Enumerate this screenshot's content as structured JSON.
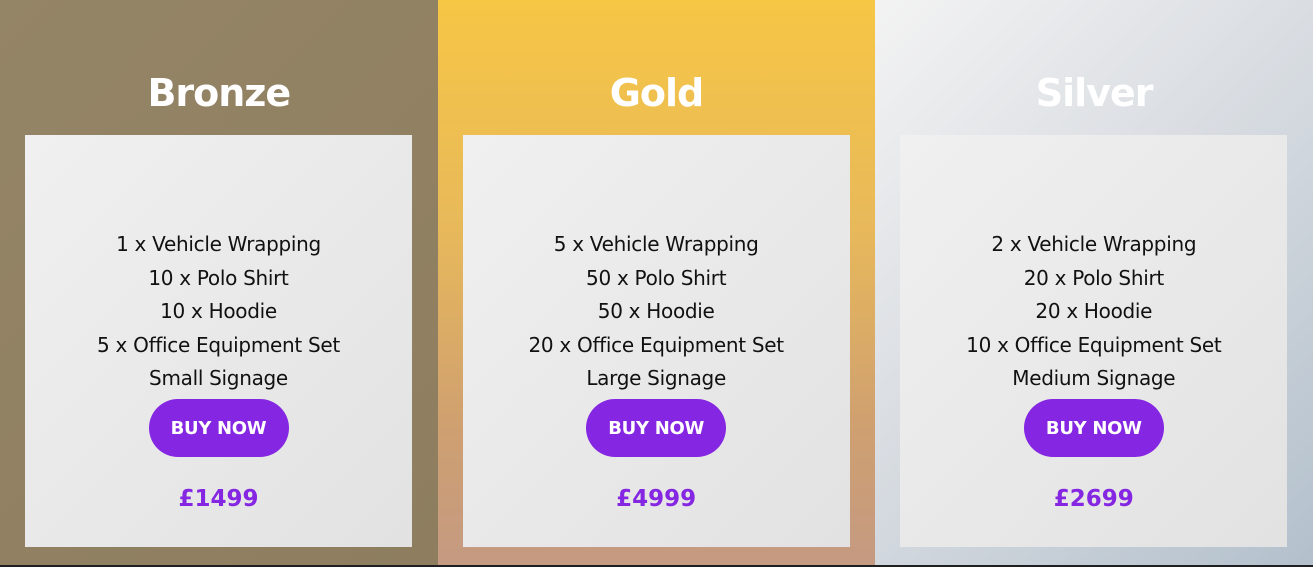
{
  "plans": [
    {
      "title": "Bronze",
      "features": [
        "1 x Vehicle Wrapping",
        "10 x Polo Shirt",
        "10 x Hoodie",
        "5 x Office Equipment Set",
        "Small Signage"
      ],
      "button_label": "BUY NOW",
      "price": "£1499"
    },
    {
      "title": "Gold",
      "features": [
        "5 x Vehicle Wrapping",
        "50 x Polo Shirt",
        "50 x Hoodie",
        "20 x Office Equipment Set",
        "Large Signage"
      ],
      "button_label": "BUY NOW",
      "price": "£4999"
    },
    {
      "title": "Silver",
      "features": [
        "2 x Vehicle Wrapping",
        "20 x Polo Shirt",
        "20 x Hoodie",
        "10 x Office Equipment Set",
        "Medium Signage"
      ],
      "button_label": "BUY NOW",
      "price": "£2699"
    }
  ],
  "colors": {
    "accent": "#8526e2",
    "bronze_bg": "#918262",
    "gold_bg": "#f6c645",
    "silver_bg": "#dde1e6",
    "card_bg": "#ebebeb",
    "title_text": "#ffffff"
  }
}
